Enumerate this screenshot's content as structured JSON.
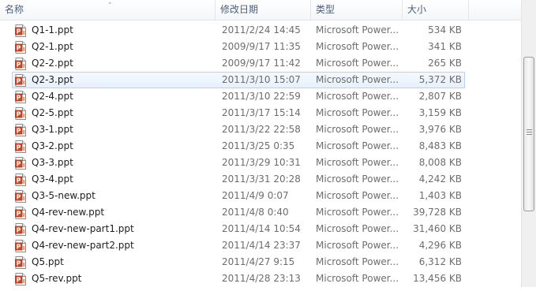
{
  "columns": {
    "name": "名称",
    "date": "修改日期",
    "type": "类型",
    "size": "大小"
  },
  "files": [
    {
      "name": "Q1-1.ppt",
      "date": "2011/2/24 14:45",
      "type": "Microsoft Power...",
      "size": "534 KB"
    },
    {
      "name": "Q2-1.ppt",
      "date": "2009/9/17 11:35",
      "type": "Microsoft Power...",
      "size": "341 KB"
    },
    {
      "name": "Q2-2.ppt",
      "date": "2009/9/17 11:42",
      "type": "Microsoft Power...",
      "size": "265 KB"
    },
    {
      "name": "Q2-3.ppt",
      "date": "2011/3/10 15:07",
      "type": "Microsoft Power...",
      "size": "5,372 KB",
      "selected": true
    },
    {
      "name": "Q2-4.ppt",
      "date": "2011/3/10 22:59",
      "type": "Microsoft Power...",
      "size": "2,807 KB"
    },
    {
      "name": "Q2-5.ppt",
      "date": "2011/3/17 15:14",
      "type": "Microsoft Power...",
      "size": "3,159 KB"
    },
    {
      "name": "Q3-1.ppt",
      "date": "2011/3/22 22:58",
      "type": "Microsoft Power...",
      "size": "3,976 KB"
    },
    {
      "name": "Q3-2.ppt",
      "date": "2011/3/25 0:35",
      "type": "Microsoft Power...",
      "size": "8,483 KB"
    },
    {
      "name": "Q3-3.ppt",
      "date": "2011/3/29 10:31",
      "type": "Microsoft Power...",
      "size": "8,008 KB"
    },
    {
      "name": "Q3-4.ppt",
      "date": "2011/3/31 20:28",
      "type": "Microsoft Power...",
      "size": "4,242 KB"
    },
    {
      "name": "Q3-5-new.ppt",
      "date": "2011/4/9 0:07",
      "type": "Microsoft Power...",
      "size": "1,403 KB"
    },
    {
      "name": "Q4-rev-new.ppt",
      "date": "2011/4/8 0:40",
      "type": "Microsoft Power...",
      "size": "39,728 KB"
    },
    {
      "name": "Q4-rev-new-part1.ppt",
      "date": "2011/4/14 10:54",
      "type": "Microsoft Power...",
      "size": "31,460 KB"
    },
    {
      "name": "Q4-rev-new-part2.ppt",
      "date": "2011/4/14 23:37",
      "type": "Microsoft Power...",
      "size": "4,296 KB"
    },
    {
      "name": "Q5.ppt",
      "date": "2011/4/27 9:15",
      "type": "Microsoft Power...",
      "size": "6,312 KB"
    },
    {
      "name": "Q5-rev.ppt",
      "date": "2011/4/28 23:13",
      "type": "Microsoft Power...",
      "size": "13,456 KB"
    }
  ],
  "icon": "powerpoint-file-icon",
  "colors": {
    "selection_border": "#b7d2ee",
    "selection_fill": "#e6f0fb",
    "header_text": "#4c607a"
  }
}
